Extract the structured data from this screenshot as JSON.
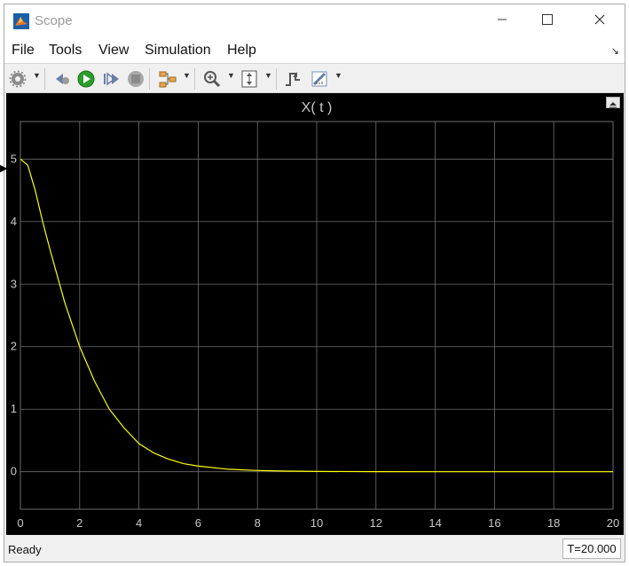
{
  "window": {
    "title": "Scope"
  },
  "menu": {
    "items": [
      "File",
      "Tools",
      "View",
      "Simulation",
      "Help"
    ]
  },
  "toolbar": {
    "buttons": [
      "settings-icon",
      "step-back-icon",
      "run-icon",
      "step-forward-icon",
      "stop-icon",
      "signal-selector-icon",
      "zoom-in-icon",
      "fit-axes-icon",
      "triggers-icon",
      "measurements-icon"
    ]
  },
  "colors": {
    "plot_background": "#000000",
    "grid": "#6e6e6e",
    "trace": "#ffff00",
    "axis_text": "#c8c8c8",
    "run_button": "#2a9d2a"
  },
  "chart_data": {
    "type": "line",
    "title": "X( t )",
    "xlabel": "",
    "ylabel": "",
    "xlim": [
      0,
      20
    ],
    "ylim": [
      -0.6,
      5.6
    ],
    "xticks": [
      0,
      2,
      4,
      6,
      8,
      10,
      12,
      14,
      16,
      18,
      20
    ],
    "yticks": [
      0,
      1,
      2,
      3,
      4,
      5
    ],
    "grid": true,
    "series": [
      {
        "color": "#ffff00",
        "x": [
          0,
          0.25,
          0.5,
          0.75,
          1,
          1.5,
          2,
          2.5,
          3,
          3.5,
          4,
          4.5,
          5,
          5.5,
          6,
          7,
          8,
          9,
          10,
          12,
          14,
          16,
          18,
          20
        ],
        "y": [
          5,
          4.9,
          4.5,
          4.0,
          3.55,
          2.7,
          2.0,
          1.45,
          1.0,
          0.7,
          0.45,
          0.3,
          0.2,
          0.13,
          0.09,
          0.04,
          0.02,
          0.01,
          0.005,
          0.001,
          0,
          0,
          0,
          0
        ]
      }
    ]
  },
  "status": {
    "text": "Ready",
    "time": "T=20.000"
  }
}
